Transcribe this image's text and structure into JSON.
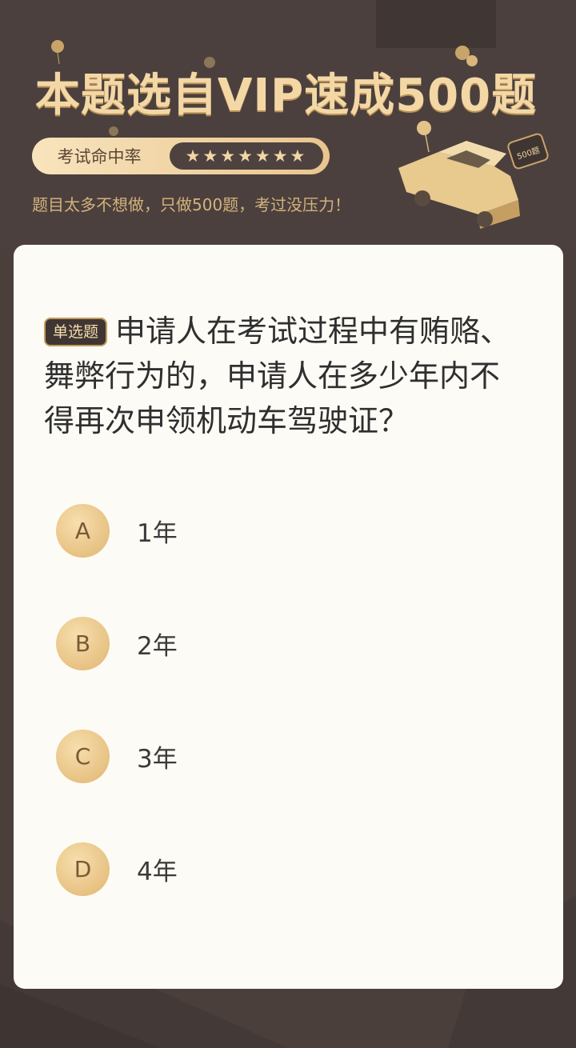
{
  "banner": {
    "title": "本题选自VIP速成500题",
    "rate_label": "考试命中率",
    "rate_stars": "★★★★★★★",
    "subtitle": "题目太多不想做，只做500题，考过没压力！",
    "car_badge": "500题"
  },
  "question": {
    "type_badge": "单选题",
    "text": "申请人在考试过程中有贿赂、舞弊行为的，申请人在多少年内不得再次申领机动车驾驶证？"
  },
  "options": [
    {
      "key": "A",
      "text": "1年"
    },
    {
      "key": "B",
      "text": "2年"
    },
    {
      "key": "C",
      "text": "3年"
    },
    {
      "key": "D",
      "text": "4年"
    }
  ],
  "colors": {
    "background": "#4a3f3b",
    "gold": "#f3d8a6",
    "card": "#fdfbf5"
  }
}
